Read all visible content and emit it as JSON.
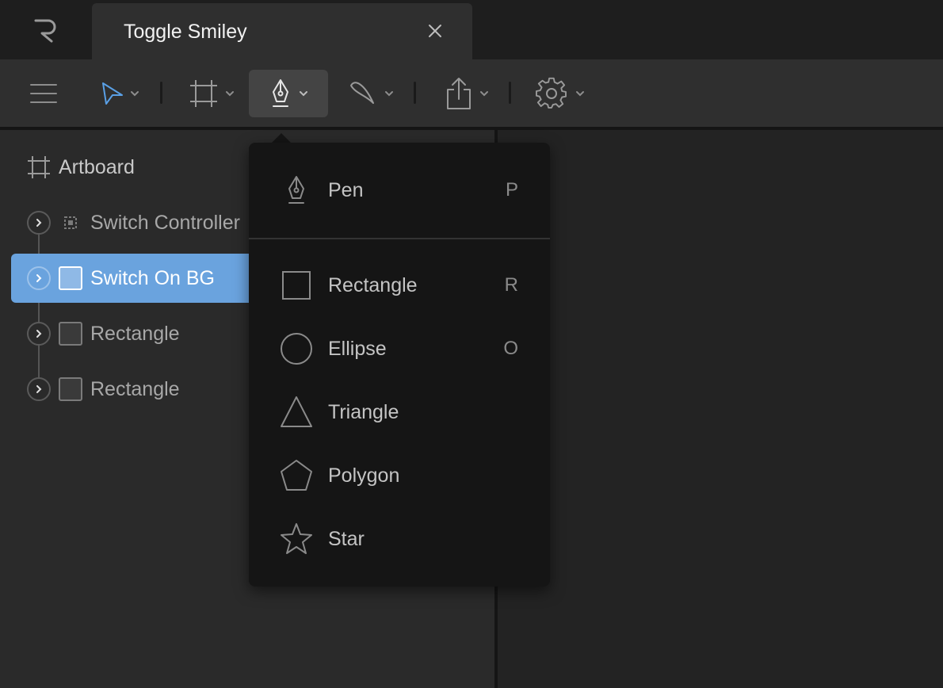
{
  "app": {
    "logo": "R",
    "tab_title": "Toggle Smiley"
  },
  "toolbar": {
    "items": [
      {
        "name": "menu",
        "icon": "hamburger-icon"
      },
      {
        "name": "select",
        "icon": "pointer-icon",
        "color": "#5aa0e6"
      },
      {
        "name": "frame",
        "icon": "frame-icon"
      },
      {
        "name": "pen",
        "icon": "pen-icon",
        "active": true
      },
      {
        "name": "paint",
        "icon": "brush-icon"
      },
      {
        "name": "export",
        "icon": "share-icon"
      },
      {
        "name": "settings",
        "icon": "gear-icon"
      }
    ]
  },
  "layers": {
    "artboard_label": "Artboard",
    "items": [
      {
        "label": "Switch Controller",
        "selected": false,
        "icon": "group-icon"
      },
      {
        "label": "Switch On BG",
        "selected": true,
        "icon": "rectangle-icon"
      },
      {
        "label": "Rectangle",
        "selected": false,
        "icon": "rectangle-icon"
      },
      {
        "label": "Rectangle",
        "selected": false,
        "icon": "rectangle-icon"
      }
    ]
  },
  "pen_menu": {
    "items": [
      {
        "label": "Pen",
        "shortcut": "P",
        "icon": "pen-icon"
      },
      {
        "label": "Rectangle",
        "shortcut": "R",
        "icon": "rectangle-icon"
      },
      {
        "label": "Ellipse",
        "shortcut": "O",
        "icon": "ellipse-icon"
      },
      {
        "label": "Triangle",
        "shortcut": "",
        "icon": "triangle-icon"
      },
      {
        "label": "Polygon",
        "shortcut": "",
        "icon": "polygon-icon"
      },
      {
        "label": "Star",
        "shortcut": "",
        "icon": "star-icon"
      }
    ]
  },
  "colors": {
    "accent": "#6aa3de",
    "select_tool": "#5aa0e6",
    "menu_bg": "#151515"
  }
}
